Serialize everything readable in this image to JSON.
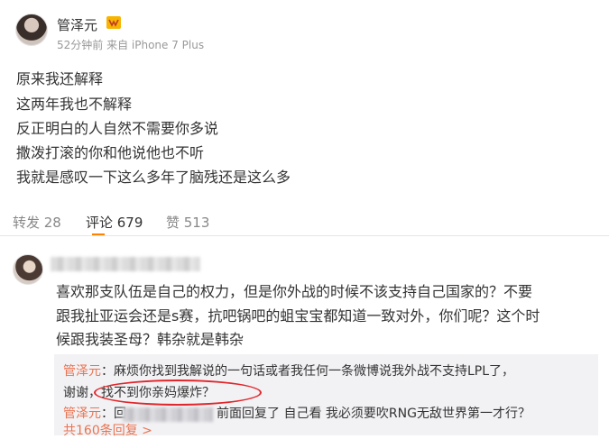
{
  "post": {
    "username": "管泽元",
    "vip_icon": "vip-badge-icon",
    "meta": "52分钟前 来自 iPhone 7 Plus",
    "lines": [
      "原来我还解释",
      "这两年我也不解释",
      "反正明白的人自然不需要你多说",
      "撒泼打滚的你和他说他也不听",
      "我就是感叹一下这么多年了脑残还是这么多"
    ]
  },
  "actions": {
    "repost": "转发 28",
    "comment": "评论 679",
    "like": "赞 513"
  },
  "comment": {
    "lines": [
      "喜欢那支队伍是自己的权力，但是你外战的时候不该支持自己国家的？不要",
      "跟我扯亚运会还是s赛，抗吧锅吧的蛆宝宝都知道一致对外，你们呢？这个时",
      "候跟我装圣母？韩杂就是韩杂"
    ],
    "replies": [
      {
        "name": "管泽元",
        "line1": "：麻烦你找到我解说的一句话或者我任何一条微博说我外战不支持LPL了，",
        "line2": "谢谢，找不到你亲妈爆炸？"
      },
      {
        "name": "管泽元",
        "prefix": "：回",
        "text": "前面回复了 自己看 我必须要吹RNG无敌世界第一才行？"
      }
    ],
    "more_replies": "共160条回复 >"
  },
  "colors": {
    "accent_orange": "#ff8200",
    "name_link": "#eb7350",
    "highlight_red": "#e0262a"
  }
}
